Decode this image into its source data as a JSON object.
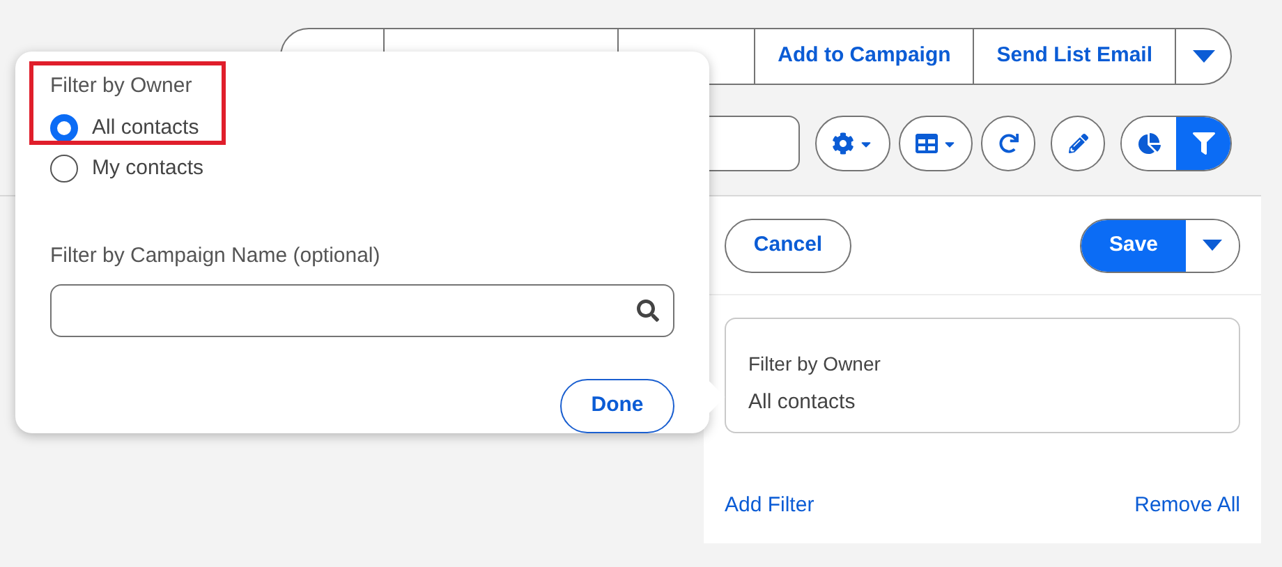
{
  "toolbar": {
    "buttons": [
      {
        "label": "Add to Campaign"
      },
      {
        "label": "Send List Email"
      }
    ]
  },
  "view_buttons": [
    {
      "selected": false
    },
    {
      "selected": true
    }
  ],
  "popover": {
    "owner_label": "Filter by Owner",
    "options": [
      {
        "label": "All contacts",
        "selected": true
      },
      {
        "label": "My contacts",
        "selected": false
      }
    ],
    "campaign_label": "Filter by Campaign Name (optional)",
    "done": "Done"
  },
  "panel": {
    "cancel": "Cancel",
    "save": "Save",
    "filters": [
      {
        "title": "Filter by Owner",
        "value": "All contacts"
      }
    ],
    "add_filter": "Add Filter",
    "remove_all": "Remove All"
  }
}
